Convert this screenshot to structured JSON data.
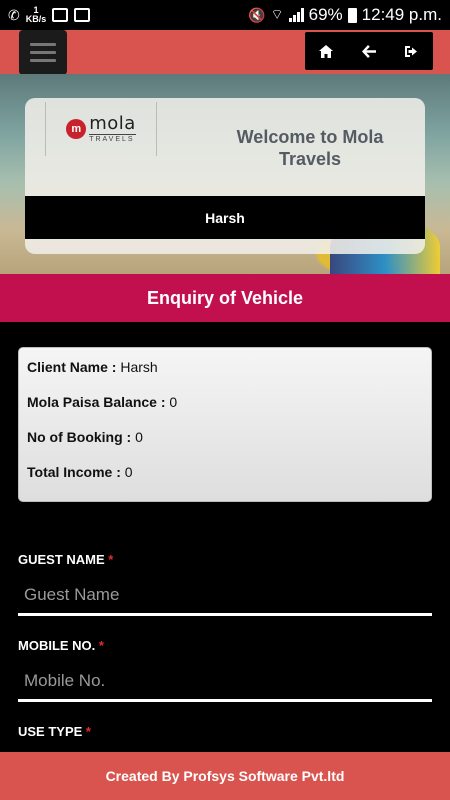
{
  "status_bar": {
    "speed_value": "1",
    "speed_unit": "KB/s",
    "battery": "69%",
    "time": "12:49 p.m."
  },
  "header": {
    "icons": [
      "menu-icon",
      "home-icon",
      "back-arrow-icon",
      "logout-icon"
    ]
  },
  "hero": {
    "logo_text": "mola",
    "logo_sub": "TRAVELS",
    "welcome": "Welcome to Mola Travels",
    "user_name": "Harsh"
  },
  "section": {
    "title": "Enquiry of Vehicle"
  },
  "info": {
    "client_name_label": "Client Name :",
    "client_name_value": "Harsh",
    "mola_paisa_label": "Mola Paisa Balance :",
    "mola_paisa_value": "0",
    "bookings_label": "No of Booking :",
    "bookings_value": "0",
    "income_label": "Total Income :",
    "income_value": "0"
  },
  "form": {
    "guest_name_label": "GUEST NAME",
    "guest_name_placeholder": "Guest Name",
    "mobile_label": "MOBILE NO.",
    "mobile_placeholder": "Mobile No.",
    "use_type_label": "USE TYPE",
    "required_mark": "*"
  },
  "footer": {
    "text": "Created By Profsys Software Pvt.ltd"
  },
  "colors": {
    "header_bg": "#d9534f",
    "section_bg": "#c2104f",
    "required": "#e52b2b"
  }
}
